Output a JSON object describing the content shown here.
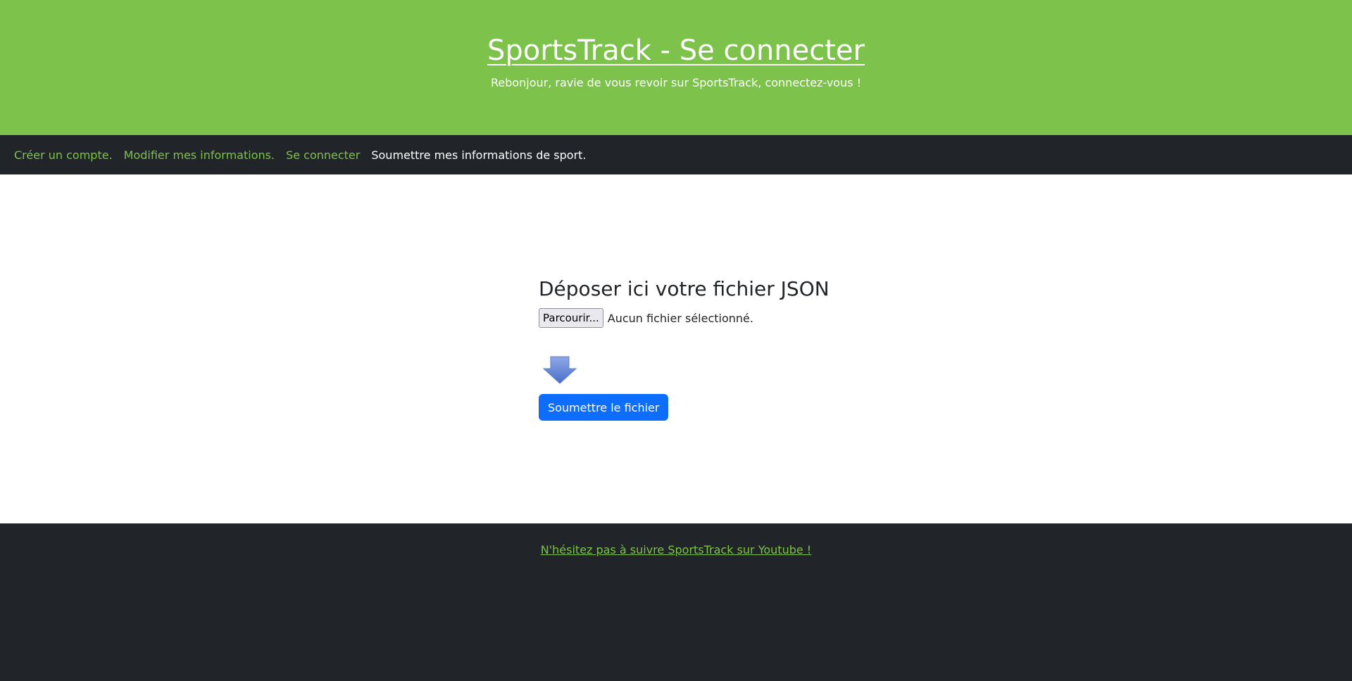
{
  "header": {
    "title": "SportsTrack - Se connecter",
    "subtitle": "Rebonjour, ravie de vous revoir sur SportsTrack, connectez-vous !"
  },
  "nav": {
    "items": [
      {
        "label": "Créer un compte."
      },
      {
        "label": "Modifier mes informations."
      },
      {
        "label": "Se connecter"
      },
      {
        "label": "Soumettre mes informations de sport."
      }
    ]
  },
  "upload": {
    "title": "Déposer ici votre fichier JSON",
    "browse_label": "Parcourir...",
    "file_status": "Aucun fichier sélectionné.",
    "arrow_icon": "down-arrow-icon",
    "submit_label": "Soumettre le fichier"
  },
  "footer": {
    "link": "N'hésitez pas à suivre SportsTrack sur Youtube !"
  },
  "colors": {
    "header_bg": "#7dc24b",
    "nav_bg": "#212529",
    "accent": "#7dc24b",
    "primary_button": "#0d6efd"
  }
}
